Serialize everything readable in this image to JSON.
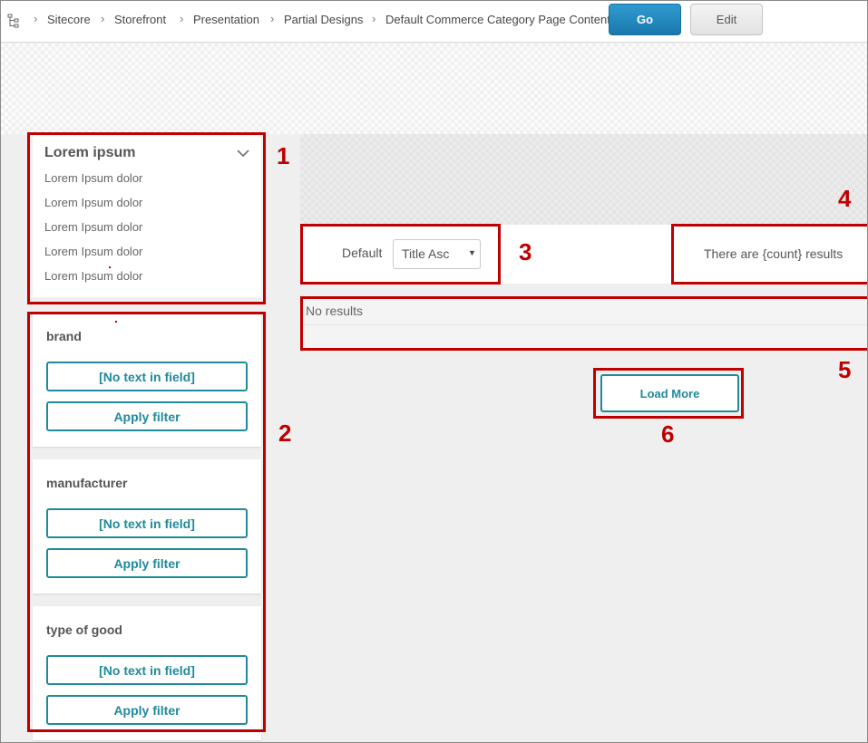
{
  "breadcrumb": {
    "items": [
      "Sitecore",
      "Storefront",
      "Presentation",
      "Partial Designs",
      "Default Commerce Category Page Content"
    ]
  },
  "toolbar": {
    "go_label": "Go",
    "edit_label": "Edit"
  },
  "facet": {
    "title": "Lorem ipsum",
    "items": [
      "Lorem Ipsum dolor",
      "Lorem Ipsum dolor",
      "Lorem Ipsum dolor",
      "Lorem Ipsum dolor",
      "Lorem Ipsum dolor"
    ]
  },
  "filters": [
    {
      "name": "brand",
      "input_text": "[No text in field]",
      "apply_label": "Apply filter"
    },
    {
      "name": "manufacturer",
      "input_text": "[No text in field]",
      "apply_label": "Apply filter"
    },
    {
      "name": "type of good",
      "input_text": "[No text in field]",
      "apply_label": "Apply filter"
    }
  ],
  "sort": {
    "label": "Default",
    "selected": "Title Asc"
  },
  "results": {
    "count_text": "There are {count} results",
    "empty_text": "No results"
  },
  "load_more_label": "Load More",
  "callouts": [
    "1",
    "2",
    "3",
    "4",
    "5",
    "6"
  ],
  "colors": {
    "accent": "#1f8a9a",
    "callout": "#c00000",
    "go_button": "#1a78ad"
  }
}
